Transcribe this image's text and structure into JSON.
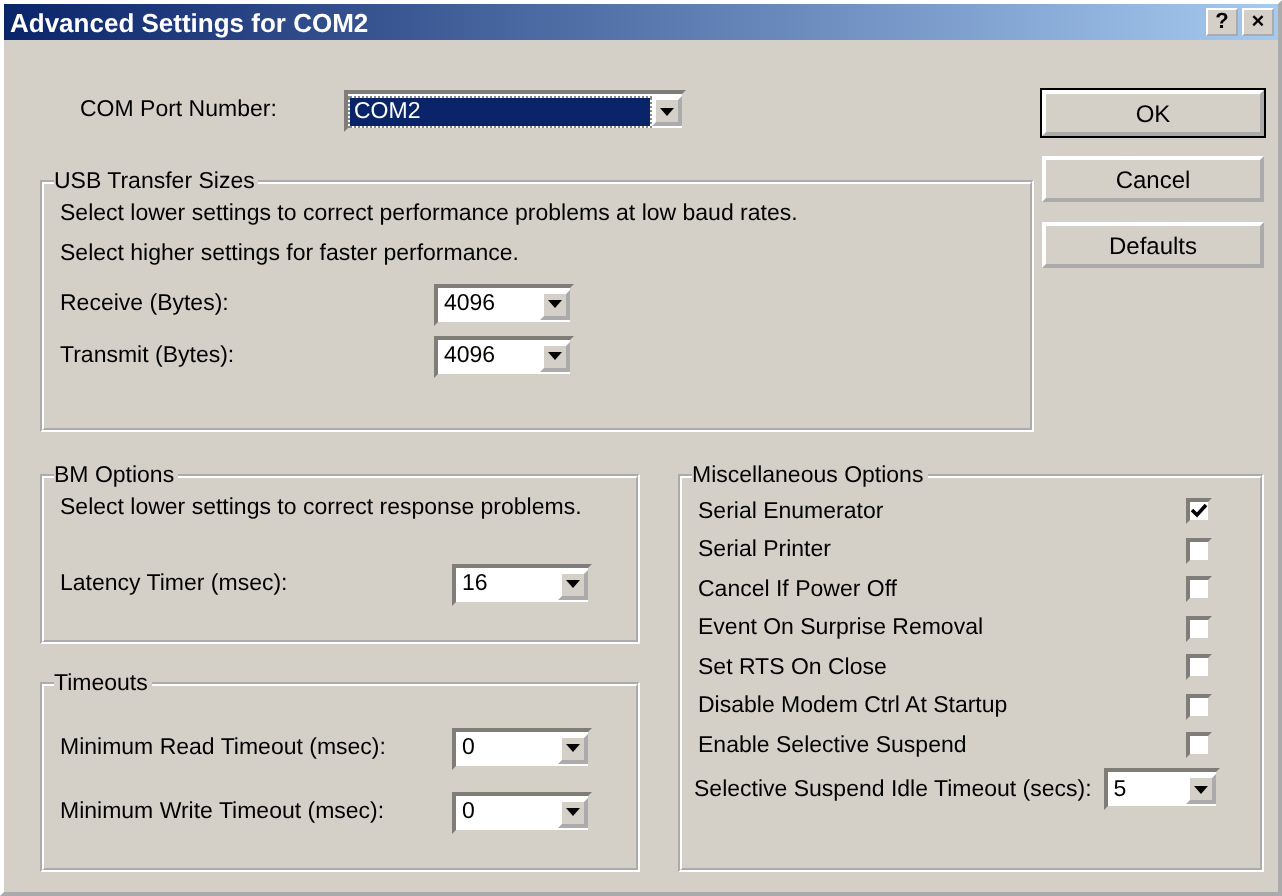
{
  "window": {
    "title": "Advanced Settings for COM2",
    "help_button": "?",
    "close_button": "×"
  },
  "com_port": {
    "label": "COM Port Number:",
    "value": "COM2",
    "highlighted": true
  },
  "usb_transfer_sizes": {
    "title": "USB Transfer Sizes",
    "notes": [
      "Select lower settings to correct performance problems at low baud rates.",
      "Select higher settings for faster performance."
    ],
    "fields": [
      {
        "label": "Receive (Bytes):",
        "value": "4096"
      },
      {
        "label": "Transmit (Bytes):",
        "value": "4096"
      }
    ]
  },
  "bm_options": {
    "title": "BM Options",
    "note": "Select lower settings to correct response problems.",
    "fields": [
      {
        "label": "Latency Timer (msec):",
        "value": "16"
      }
    ]
  },
  "timeouts": {
    "title": "Timeouts",
    "fields": [
      {
        "label": "Minimum Read Timeout (msec):",
        "value": "0"
      },
      {
        "label": "Minimum Write Timeout (msec):",
        "value": "0"
      }
    ]
  },
  "miscellaneous_options": {
    "title": "Miscellaneous Options",
    "options": [
      {
        "label": "Serial Enumerator",
        "checked": true
      },
      {
        "label": "Serial Printer",
        "checked": false
      },
      {
        "label": "Cancel If Power Off",
        "checked": false
      },
      {
        "label": "Event On Surprise Removal",
        "checked": false
      },
      {
        "label": "Set RTS On Close",
        "checked": false
      },
      {
        "label": "Disable Modem Ctrl At Startup",
        "checked": false
      },
      {
        "label": "Enable Selective Suspend",
        "checked": false
      }
    ],
    "fields": [
      {
        "label": "Selective Suspend Idle Timeout (secs):",
        "value": "5"
      }
    ]
  },
  "buttons": [
    {
      "label": "OK",
      "default": true
    },
    {
      "label": "Cancel",
      "default": false
    },
    {
      "label": "Defaults",
      "default": false
    }
  ]
}
